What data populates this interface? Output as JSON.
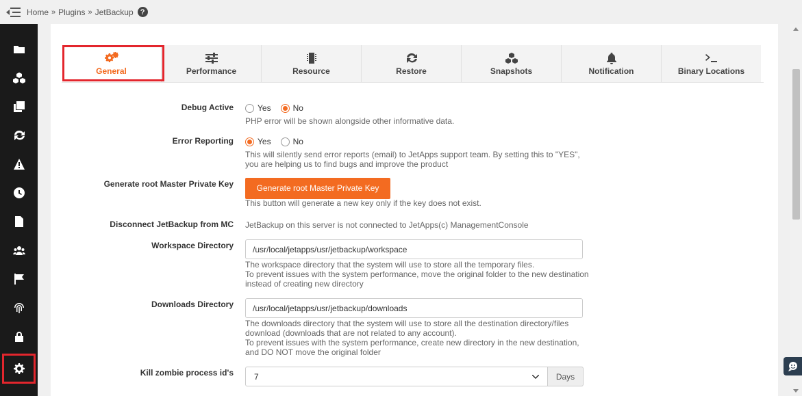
{
  "breadcrumb": {
    "home": "Home",
    "sep1": "»",
    "plugins": "Plugins",
    "sep2": "»",
    "current": "JetBackup"
  },
  "tabs": [
    {
      "label": "General",
      "icon": "gears-icon"
    },
    {
      "label": "Performance",
      "icon": "sliders-icon"
    },
    {
      "label": "Resource",
      "icon": "chip-icon"
    },
    {
      "label": "Restore",
      "icon": "refresh-icon"
    },
    {
      "label": "Snapshots",
      "icon": "cubes-icon"
    },
    {
      "label": "Notification",
      "icon": "bell-icon"
    },
    {
      "label": "Binary Locations",
      "icon": "terminal-icon"
    }
  ],
  "form": {
    "debug": {
      "label": "Debug Active",
      "options": [
        "Yes",
        "No"
      ],
      "selected": "No",
      "help": "PHP error will be shown alongside other informative data."
    },
    "error_reporting": {
      "label": "Error Reporting",
      "options": [
        "Yes",
        "No"
      ],
      "selected": "Yes",
      "help1": "This will silently send error reports (email) to JetApps support team. By setting this to \"YES\",",
      "help2": "you are helping us to find bugs and improve the product"
    },
    "master_key": {
      "label": "Generate root Master Private Key",
      "button": "Generate root Master Private Key",
      "help": "This button will generate a new key only if the key does not exist."
    },
    "disconnect": {
      "label": "Disconnect JetBackup from MC",
      "value": "JetBackup on this server is not connected to JetApps(c) ManagementConsole"
    },
    "workspace": {
      "label": "Workspace Directory",
      "value": "/usr/local/jetapps/usr/jetbackup/workspace",
      "help1": "The workspace directory that the system will use to store all the temporary files.",
      "help2": "To prevent issues with the system performance, move the original folder to the new destination",
      "help3": "instead of creating new directory"
    },
    "downloads": {
      "label": "Downloads Directory",
      "value": "/usr/local/jetapps/usr/jetbackup/downloads",
      "help1": "The downloads directory that the system will use to store all the destination directory/files",
      "help2": "download (downloads that are not related to any account).",
      "help3": "To prevent issues with the system performance, create new directory in the new destination,",
      "help4": "and DO NOT move the original folder"
    },
    "zombie": {
      "label": "Kill zombie process id's",
      "value": "7",
      "addon": "Days"
    }
  },
  "colors": {
    "accent": "#f36b21",
    "highlight": "#e3262d",
    "sidebar": "#1a1a1a"
  }
}
